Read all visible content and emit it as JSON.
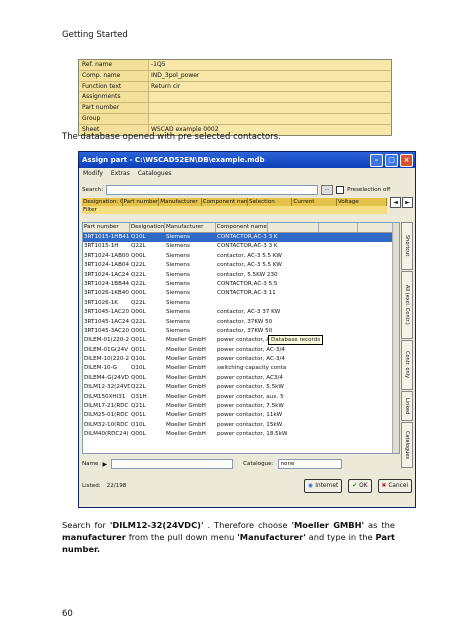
{
  "header": {
    "title": "Getting Started"
  },
  "properties": [
    {
      "label": "Ref. name",
      "value": "-1Q5"
    },
    {
      "label": "Comp. name",
      "value": "IND_3pol_power"
    },
    {
      "label": "Function text",
      "value": "Return cir"
    },
    {
      "label": "Assignments",
      "value": ""
    },
    {
      "label": "Part number",
      "value": ""
    },
    {
      "label": "Group",
      "value": ""
    },
    {
      "label": "Sheet",
      "value": "WSCAD example 0002"
    }
  ],
  "caption1": "The database opened with pre selected contactors.",
  "dialog": {
    "title": "Assign part - C:\\WSCAD52EN\\DB\\example.mdb",
    "menu": [
      "Modify",
      "Extras",
      "Catalogues"
    ],
    "search_label": "Search:",
    "preselection_label": "Preselection off",
    "filter_headers": [
      "Designation: Q",
      "Part number",
      "Manufacturer",
      "Component nam",
      "Selection",
      "Current",
      "Voltage"
    ],
    "filter_label": "Filter",
    "columns": [
      "Part number",
      "Designation",
      "Manufacturer",
      "Component name",
      "",
      "",
      ""
    ],
    "rows": [
      {
        "part": "3RT1015-1HB41",
        "des": "Q10L",
        "man": "Siemens",
        "comp": "CONTACTOR,AC-3 3 K"
      },
      {
        "part": "3RT1015-1H",
        "des": "Q22L",
        "man": "Siemens",
        "comp": "CONTACTOR,AC-3 3 K"
      },
      {
        "part": "3RT1024-1AB00",
        "des": "Q00L",
        "man": "Siemens",
        "comp": "contactor, AC-3 5.5 KW"
      },
      {
        "part": "3RT1024-1AB04",
        "des": "Q22L",
        "man": "Siemens",
        "comp": "contactor, AC-3 5.5 KW"
      },
      {
        "part": "3RT1024-1AC24",
        "des": "Q22L",
        "man": "Siemens",
        "comp": "contactor, 5.5KW 230"
      },
      {
        "part": "3RT1024-1BB44",
        "des": "Q22L",
        "man": "Siemens",
        "comp": "CONTACTOR,AC-3 5.5"
      },
      {
        "part": "3RT1026-1KB40",
        "des": "Q00L",
        "man": "Siemens",
        "comp": "CONTACTOR,AC-3 11"
      },
      {
        "part": "3RT1026-1K",
        "des": "Q22L",
        "man": "Siemens",
        "comp": ""
      },
      {
        "part": "3RT1045-1AC20",
        "des": "Q00L",
        "man": "Siemens",
        "comp": "contactor, AC-3 37 KW"
      },
      {
        "part": "3RT1045-1AC24",
        "des": "Q22L",
        "man": "Siemens",
        "comp": "contactor, 37KW 50"
      },
      {
        "part": "3RT1045-3AC20",
        "des": "Q00L",
        "man": "Siemens",
        "comp": "contactor, 37KW 50"
      },
      {
        "part": "DILEM-01(220-2",
        "des": "Q01L",
        "man": "Moeller GmbH",
        "comp": "power contactor, AC-3/4"
      },
      {
        "part": "DILEM-01G(24V",
        "des": "Q01L",
        "man": "Moeller GmbH",
        "comp": "power contactor, AC-3/4"
      },
      {
        "part": "DILEM-10(220-2",
        "des": "Q10L",
        "man": "Moeller GmbH",
        "comp": "power contactor, AC-3/4"
      },
      {
        "part": "DILEM-10-G",
        "des": "Q10L",
        "man": "Moeller GmbH",
        "comp": "switching capacity conta"
      },
      {
        "part": "DILEM4-G(24VD",
        "des": "Q00L",
        "man": "Moeller GmbH",
        "comp": "power contactor, AC3/4"
      },
      {
        "part": "DILM12-32(24VD",
        "des": "Q22L",
        "man": "Moeller GmbH",
        "comp": "power contactor, 5.5kW"
      },
      {
        "part": "DILM150XHI31",
        "des": "Q31H",
        "man": "Moeller GmbH",
        "comp": "power contactor, aux. 5"
      },
      {
        "part": "DILM17-21(RDC",
        "des": "Q21L",
        "man": "Moeller GmbH",
        "comp": "power contactor, 7.5kW"
      },
      {
        "part": "DILM25-01(RDC",
        "des": "Q01L",
        "man": "Moeller GmbH",
        "comp": "power contactor, 11kW"
      },
      {
        "part": "DILM32-10(RDC",
        "des": "Q10L",
        "man": "Moeller GmbH",
        "comp": "power contactor, 15kW"
      },
      {
        "part": "DILM40(RDC24)",
        "des": "Q00L",
        "man": "Moeller GmbH",
        "comp": "power contactor, 18.5kW"
      }
    ],
    "tooltip": "Database records",
    "side_tabs": [
      "Shortcut",
      "All (excl. Contr.)",
      "Contr. only",
      "Linked",
      "Catalogues"
    ],
    "name_label": "Name",
    "catalogue_label": "Catalogue:",
    "catalogue_value": "none",
    "listed_label": "Listed:",
    "listed_value": "22/198",
    "btn_internet": "Internet",
    "btn_ok": "OK",
    "btn_cancel": "Cancel"
  },
  "caption2": {
    "p1": "Search for ",
    "b1": "'DILM12-32(24VDC)'",
    "p2": " . Therefore choose ",
    "b2": "'Moeller GMBH'",
    "p3": " as the ",
    "b3": "manufacturer",
    "p4": " from the pull down menu ",
    "b4": "'Manufacturer'",
    "p5": " and type in the ",
    "b5": "Part number."
  },
  "page_number": "60"
}
